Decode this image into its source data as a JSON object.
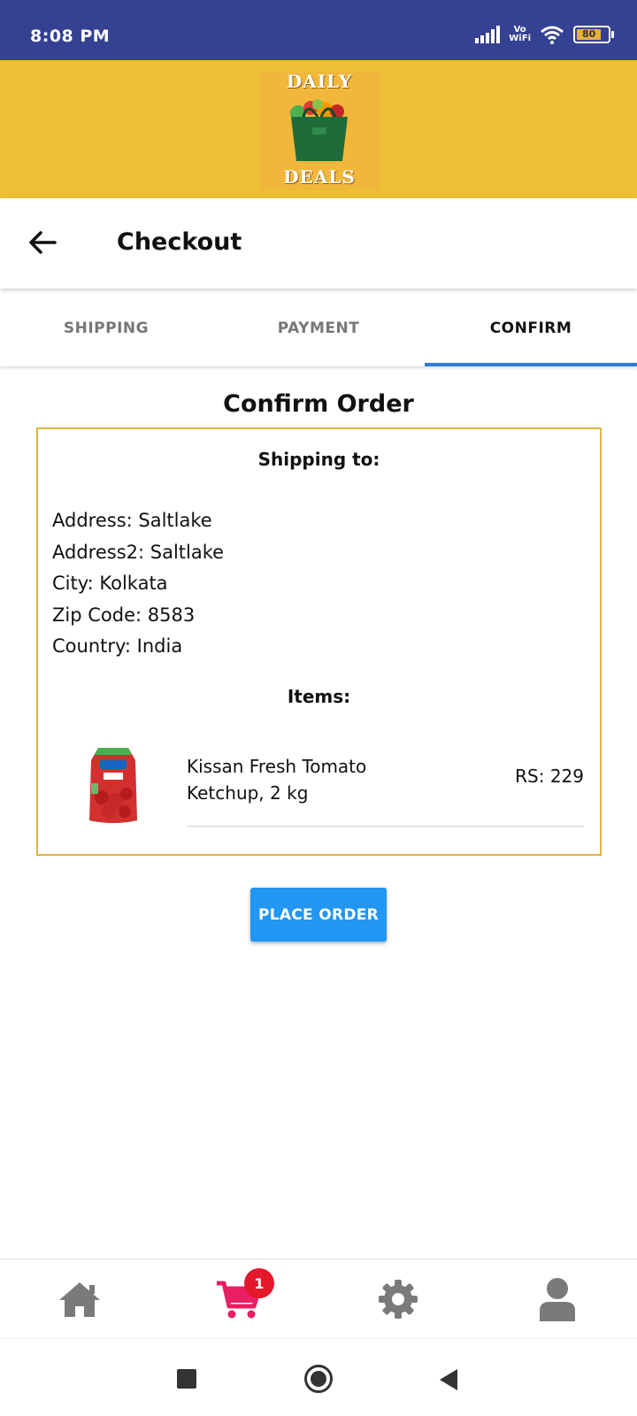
{
  "status_bar": {
    "time": "8:08 PM",
    "vowifi_line1": "Vo",
    "vowifi_line2": "WiFi",
    "battery_level": "80",
    "icons": [
      "signal-icon",
      "vowifi-icon",
      "wifi-icon",
      "battery-icon"
    ]
  },
  "brand": {
    "logo_top": "DAILY",
    "logo_bottom": "DEALS",
    "colors": {
      "header_bg": "#ecbf35",
      "status_bar_bg": "#354193"
    }
  },
  "app_bar": {
    "title": "Checkout",
    "back_icon": "back-arrow-icon"
  },
  "tabs": [
    {
      "label": "SHIPPING",
      "active": false
    },
    {
      "label": "PAYMENT",
      "active": false
    },
    {
      "label": "CONFIRM",
      "active": true
    }
  ],
  "confirm": {
    "heading": "Confirm Order",
    "shipping_heading": "Shipping to:",
    "address": {
      "address": "Address: Saltlake",
      "address2": "Address2: Saltlake",
      "city": "City: Kolkata",
      "zip": "Zip Code: 8583",
      "country": "Country: India"
    },
    "items_heading": "Items:",
    "items": [
      {
        "name": "Kissan Fresh Tomato Ketchup, 2 kg",
        "price": "RS: 229"
      }
    ]
  },
  "actions": {
    "place_order": "PLACE ORDER",
    "accent_color": "#2196f3"
  },
  "bottom_nav": {
    "items": [
      "home-icon",
      "cart-icon",
      "settings-icon",
      "user-icon"
    ],
    "cart_count": "1",
    "badge_color": "#e3182a"
  }
}
